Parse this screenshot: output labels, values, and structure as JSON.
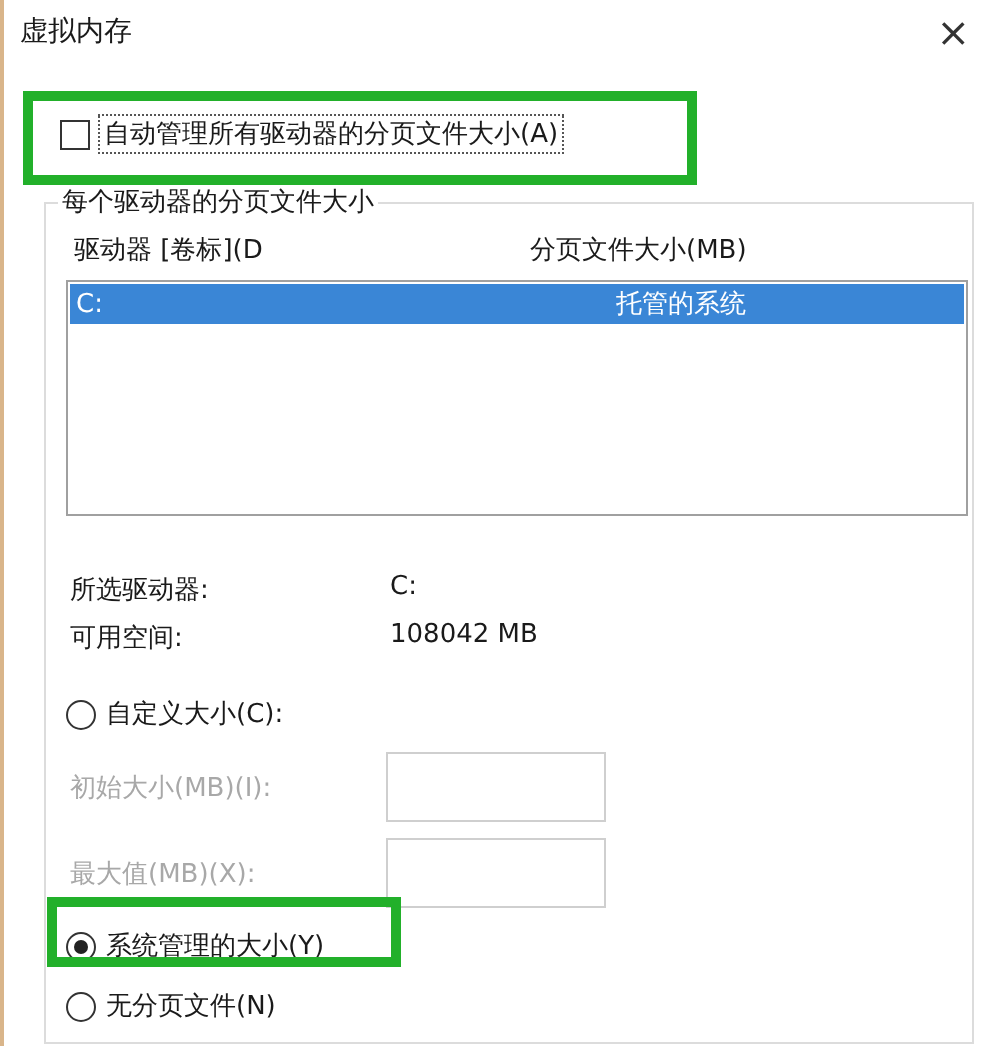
{
  "window": {
    "title": "虚拟内存",
    "close": "×"
  },
  "auto_manage": {
    "label": "自动管理所有驱动器的分页文件大小(A)",
    "checked": false
  },
  "group": {
    "legend": "每个驱动器的分页文件大小",
    "columns": [
      "驱动器 [卷标](D",
      "分页文件大小(MB)"
    ],
    "rows": [
      {
        "drive": "C:",
        "size": "托管的系统",
        "selected": true
      }
    ],
    "info": [
      {
        "label": "所选驱动器:",
        "value": "C:"
      },
      {
        "label": "可用空间:",
        "value": "108042 MB"
      }
    ],
    "options": [
      {
        "kind": "custom",
        "label": "自定义大小(C):",
        "selected": false,
        "fields": [
          {
            "label": "初始大小(MB)(I):",
            "disabled": true
          },
          {
            "label": "最大值(MB)(X):",
            "disabled": true
          }
        ]
      },
      {
        "kind": "plain",
        "label": "系统管理的大小(Y)",
        "selected": true
      },
      {
        "kind": "plain",
        "label": "无分页文件(N)",
        "selected": false
      }
    ]
  }
}
